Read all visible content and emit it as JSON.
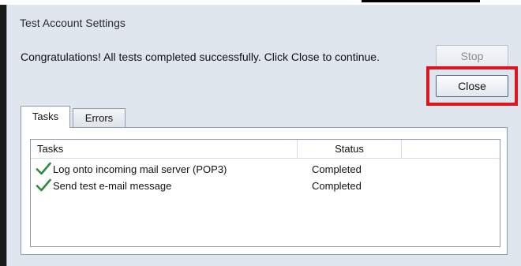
{
  "window": {
    "title": "Test Account Settings"
  },
  "message": "Congratulations! All tests completed successfully. Click Close to continue.",
  "buttons": {
    "stop": "Stop",
    "close": "Close"
  },
  "tabs": [
    {
      "label": "Tasks",
      "selected": true
    },
    {
      "label": "Errors",
      "selected": false
    }
  ],
  "table": {
    "columns": [
      "Tasks",
      "Status"
    ],
    "rows": [
      {
        "task": "Log onto incoming mail server (POP3)",
        "status": "Completed",
        "icon": "checkmark-icon"
      },
      {
        "task": "Send test e-mail message",
        "status": "Completed",
        "icon": "checkmark-icon"
      }
    ]
  },
  "colors": {
    "highlight": "#e0141c",
    "check": "#2e8b3a",
    "dialog_bg": "#dfe6ee"
  }
}
